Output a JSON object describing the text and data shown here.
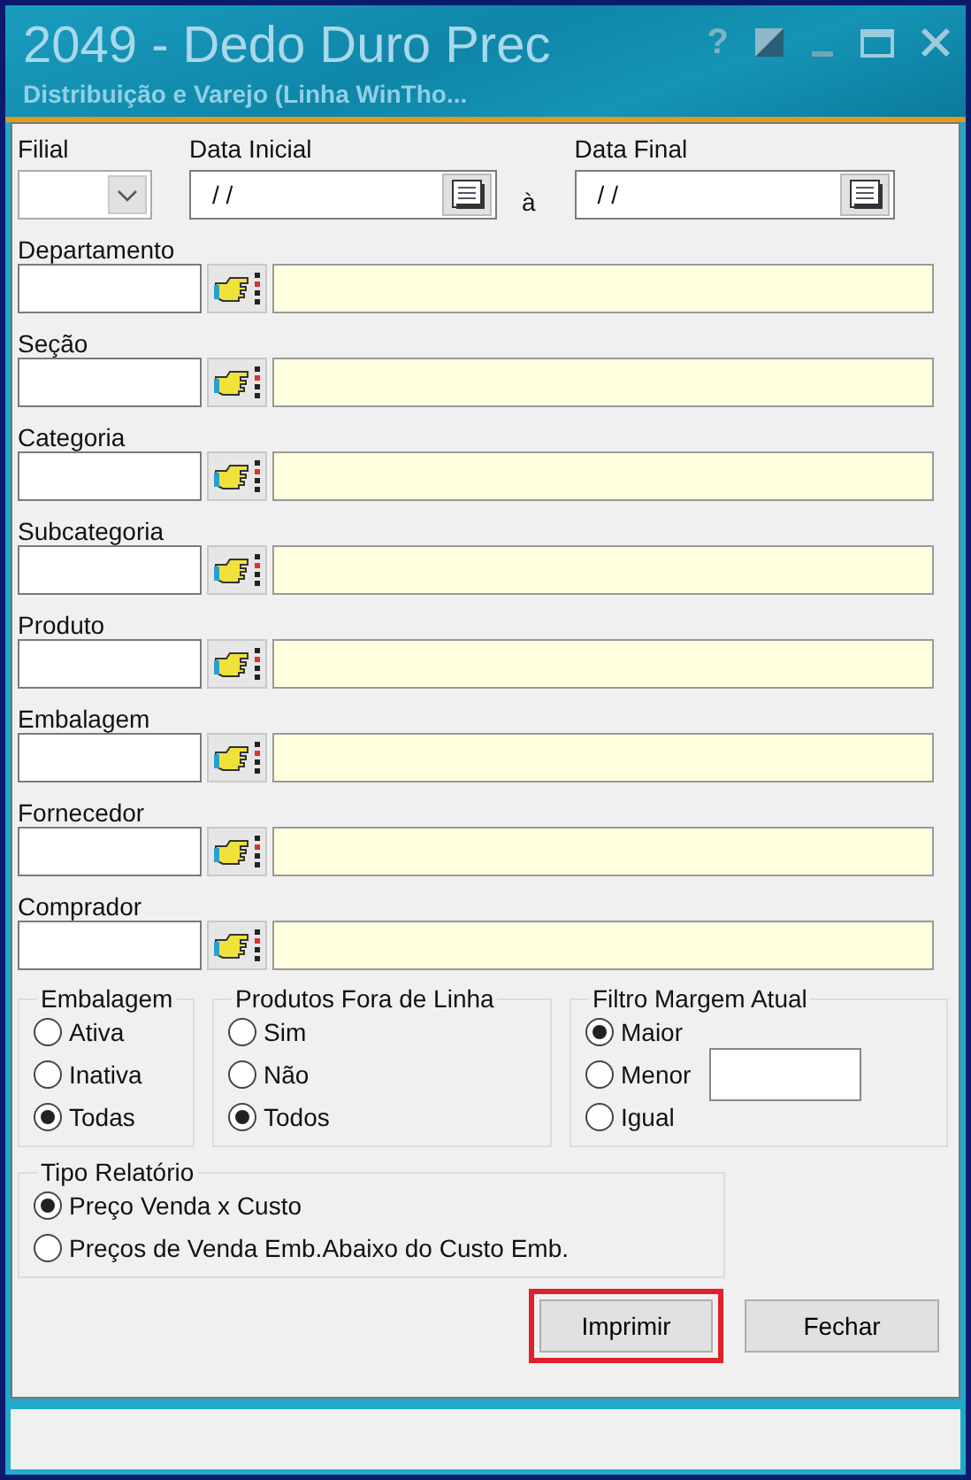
{
  "window": {
    "title": "2049 - Dedo Duro Prec",
    "subtitle": "Distribuição e Varejo (Linha WinTho...",
    "help": "?"
  },
  "header": {
    "filial": {
      "label": "Filial"
    },
    "data_inicial": {
      "label": "Data Inicial",
      "value": "/ /"
    },
    "separator": "à",
    "data_final": {
      "label": "Data Final",
      "value": "/ /"
    }
  },
  "lookups": [
    {
      "label": "Departamento"
    },
    {
      "label": "Seção"
    },
    {
      "label": "Categoria"
    },
    {
      "label": "Subcategoria"
    },
    {
      "label": "Produto"
    },
    {
      "label": "Embalagem"
    },
    {
      "label": "Fornecedor"
    },
    {
      "label": "Comprador"
    }
  ],
  "groups": [
    {
      "title": "Embalagem",
      "options": [
        {
          "label": "Ativa",
          "selected": false
        },
        {
          "label": "Inativa",
          "selected": false
        },
        {
          "label": "Todas",
          "selected": true
        }
      ]
    },
    {
      "title": "Produtos Fora de Linha",
      "options": [
        {
          "label": "Sim",
          "selected": false
        },
        {
          "label": "Não",
          "selected": false
        },
        {
          "label": "Todos",
          "selected": true
        }
      ]
    },
    {
      "title": "Filtro Margem Atual",
      "has_field": true,
      "options": [
        {
          "label": "Maior",
          "selected": true
        },
        {
          "label": "Menor",
          "selected": false
        },
        {
          "label": "Igual",
          "selected": false
        }
      ]
    }
  ],
  "tipo_relatorio": {
    "title": "Tipo Relatório",
    "options": [
      {
        "label": "Preço Venda x Custo",
        "selected": true
      },
      {
        "label": "Preços de Venda Emb.Abaixo do Custo Emb.",
        "selected": false
      }
    ]
  },
  "buttons": [
    {
      "label": "Imprimir",
      "highlighted": true
    },
    {
      "label": "Fechar",
      "highlighted": false
    }
  ]
}
